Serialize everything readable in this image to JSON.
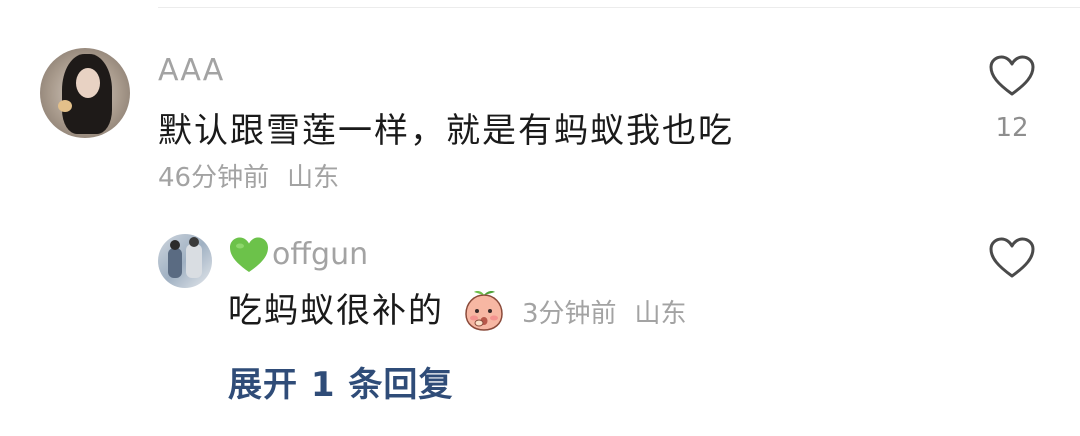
{
  "comment": {
    "username": "AAA",
    "text": "默认跟雪莲一样，就是有蚂蚁我也吃",
    "time": "46分钟前",
    "location": "山东",
    "like_count": "12"
  },
  "reply": {
    "username": "offgun",
    "username_emoji": "green-heart-icon",
    "text": "吃蚂蚁很补的",
    "text_emoji": "peach-face-emoji-icon",
    "time": "3分钟前",
    "location": "山东"
  },
  "expand": {
    "label": "展开 1 条回复"
  },
  "colors": {
    "accent_link": "#2f4c78",
    "muted_text": "#a3a3a3",
    "heart_emoji": "#6cc24a"
  }
}
